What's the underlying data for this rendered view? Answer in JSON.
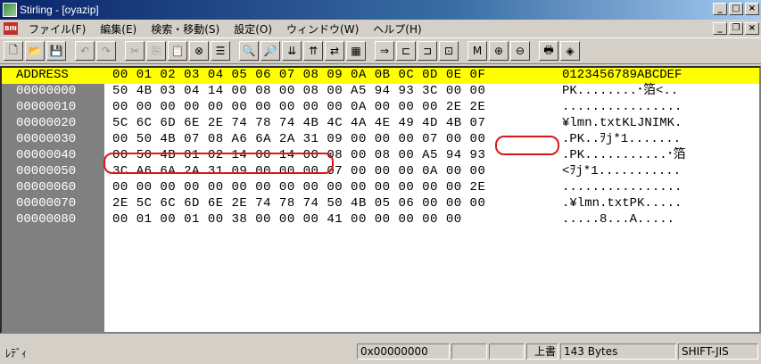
{
  "window": {
    "title": "Stirling - [oyazip]"
  },
  "menu": {
    "icon": "BIN",
    "items": [
      "ファイル(F)",
      "編集(E)",
      "検索・移動(S)",
      "設定(O)",
      "ウィンドウ(W)",
      "ヘルプ(H)"
    ]
  },
  "toolbar": {
    "icons": [
      "new-file-icon",
      "open-folder-icon",
      "save-icon",
      "undo-icon",
      "redo-icon",
      "cut-icon",
      "copy-icon",
      "paste-icon",
      "delete-icon",
      "list-icon",
      "find-icon",
      "find-next-icon",
      "find-prev-icon",
      "find-back-icon",
      "replace-icon",
      "compare-icon",
      "jump-icon",
      "insert-icon",
      "overwrite-icon",
      "split-icon",
      "mark-icon",
      "mark-next-icon",
      "mark-prev-icon",
      "print-icon",
      "settings-icon"
    ],
    "glyphs": [
      "🗋",
      "📂",
      "💾",
      "↶",
      "↷",
      "✂",
      "⎘",
      "📋",
      "⊗",
      "☰",
      "🔍",
      "🔎",
      "⇊",
      "⇈",
      "⇄",
      "▦",
      "⇒",
      "⊏",
      "⊐",
      "⊡",
      "M",
      "⊕",
      "⊖",
      "🖶",
      "◈"
    ]
  },
  "hex_header": {
    "address": "ADDRESS",
    "hex": "00 01 02 03 04 05 06 07 08 09 0A 0B 0C 0D 0E 0F",
    "ascii": "0123456789ABCDEF"
  },
  "rows": [
    {
      "address": "00000000",
      "hex": "50 4B 03 04 14 00 08 00 08 00 A5 94 93 3C 00 00",
      "ascii": "PK........･箔<.."
    },
    {
      "address": "00000010",
      "hex": "00 00 00 00 00 00 00 00 00 00 0A 00 00 00 2E 2E",
      "ascii": "................"
    },
    {
      "address": "00000020",
      "hex": "5C 6C 6D 6E 2E 74 78 74 4B 4C 4A 4E 49 4D 4B 07",
      "ascii": "¥lmn.txtKLJNIMK."
    },
    {
      "address": "00000030",
      "hex": "00 50 4B 07 08 A6 6A 2A 31 09 00 00 00 07 00 00",
      "ascii": ".PK..ｦj*1......."
    },
    {
      "address": "00000040",
      "hex": "00 50 4B 01 02 14 00 14 00 08 00 08 00 A5 94 93",
      "ascii": ".PK...........･箔"
    },
    {
      "address": "00000050",
      "hex": "3C A6 6A 2A 31 09 00 00 00 07 00 00 00 0A 00 00",
      "ascii": "<ｦj*1..........."
    },
    {
      "address": "00000060",
      "hex": "00 00 00 00 00 00 00 00 00 00 00 00 00 00 00 2E",
      "ascii": "................"
    },
    {
      "address": "00000070",
      "hex": "2E 5C 6C 6D 6E 2E 74 78 74 50 4B 05 06 00 00 00",
      "ascii": ".¥lmn.txtPK....."
    },
    {
      "address": "00000080",
      "hex": "00 01 00 01 00 38 00 00 00 41 00 00 00 00 00",
      "ascii": ".....8...A....."
    }
  ],
  "status": {
    "ready": "ﾚﾃﾞｨ",
    "offset": "0x00000000",
    "mode": "上書",
    "size": "143 Bytes",
    "encoding": "SHIFT-JIS"
  },
  "colors": {
    "header_bg": "#ffff00",
    "address_bg": "#808080",
    "highlight": "#d81818"
  }
}
